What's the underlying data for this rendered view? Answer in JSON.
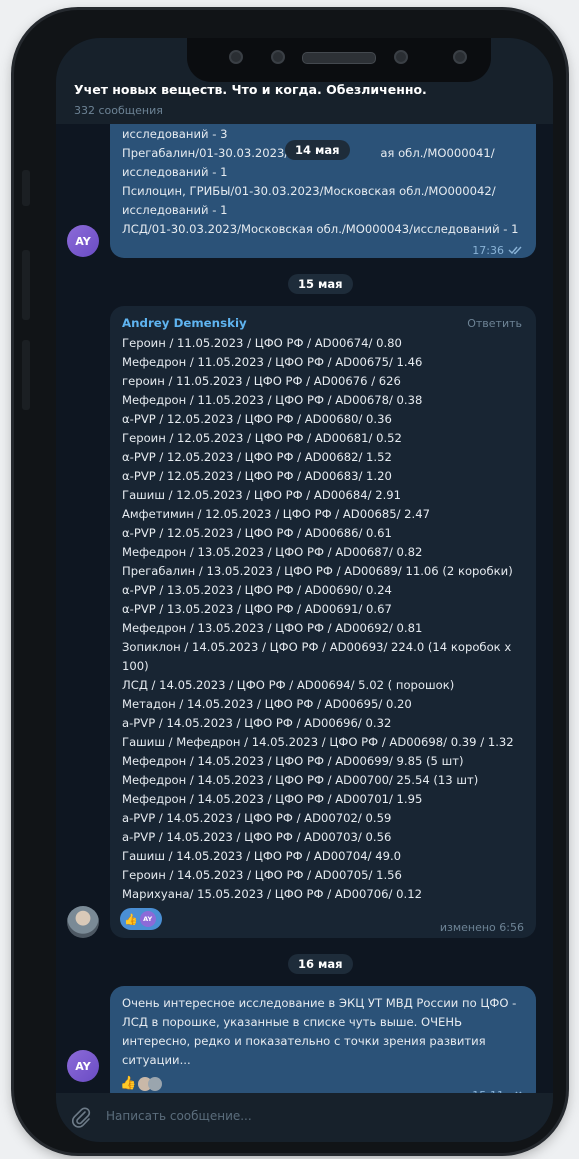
{
  "header": {
    "title": "Учет новых веществ. Что и когда. Обезличенно.",
    "subtitle": "332 сообщения"
  },
  "dates": {
    "floating": "14 мая",
    "d15": "15 мая",
    "d16": "16 мая"
  },
  "msg1": {
    "lines": [
      "исследований - 3",
      "Прегабалин/01-30.03.2023/М",
      "ая обл./МО000041/",
      "исследований - 1",
      "Псилоцин, ГРИБЫ/01-30.03.2023/Московская обл./МО000042/",
      "исследований - 1",
      "ЛСД/01-30.03.2023/Московская обл./МО000043/исследований - 1"
    ],
    "time": "17:36",
    "avatar": "AY"
  },
  "msg2": {
    "sender": "Andrey Demenskiy",
    "reply": "Ответить",
    "lines": [
      "Героин / 11.05.2023 / ЦФО РФ / AD00674/ 0.80",
      "Мефедрон / 11.05.2023 / ЦФО РФ / AD00675/ 1.46",
      "героин / 11.05.2023 / ЦФО РФ / AD00676 / 626",
      "Мефедрон / 11.05.2023 / ЦФО РФ / AD00678/ 0.38",
      "α-PVP / 12.05.2023 / ЦФО РФ / AD00680/ 0.36",
      "Героин / 12.05.2023 / ЦФО РФ / AD00681/ 0.52",
      "α-PVP / 12.05.2023 / ЦФО РФ / AD00682/ 1.52",
      "α-PVP / 12.05.2023 / ЦФО РФ / AD00683/ 1.20",
      "Гашиш / 12.05.2023 / ЦФО РФ / AD00684/ 2.91",
      "Амфетимин / 12.05.2023 / ЦФО РФ / AD00685/ 2.47",
      "α-PVP / 12.05.2023 / ЦФО РФ / AD00686/ 0.61",
      "Мефедрон / 13.05.2023 / ЦФО РФ / AD00687/ 0.82",
      "Прегабалин / 13.05.2023 / ЦФО РФ / AD00689/ 11.06 (2 коробки)",
      "α-PVP / 13.05.2023 / ЦФО РФ / AD00690/ 0.24",
      "α-PVP / 13.05.2023 / ЦФО РФ / AD00691/ 0.67",
      "Мефедрон / 13.05.2023 / ЦФО РФ / AD00692/ 0.81",
      "Зопиклон / 14.05.2023 / ЦФО РФ / AD00693/ 224.0 (14 коробок х",
      "100)",
      "ЛСД / 14.05.2023 / ЦФО РФ / AD00694/ 5.02 ( порошок)",
      "Метадон / 14.05.2023 / ЦФО РФ / AD00695/ 0.20",
      "a-PVP / 14.05.2023 / ЦФО РФ / AD00696/ 0.32",
      "Гашиш / Мефедрон / 14.05.2023 / ЦФО РФ / AD00698/ 0.39 / 1.32",
      "Мефедрон / 14.05.2023 / ЦФО РФ / AD00699/ 9.85 (5 шт)",
      "Мефедрон / 14.05.2023 / ЦФО РФ / AD00700/ 25.54 (13 шт)",
      "Мефедрон / 14.05.2023 / ЦФО РФ / AD00701/ 1.95",
      "a-PVP / 14.05.2023 / ЦФО РФ / AD00702/ 0.59",
      "a-PVP / 14.05.2023 / ЦФО РФ / AD00703/ 0.56",
      "Гашиш / 14.05.2023 / ЦФО РФ / AD00704/ 49.0",
      "Героин / 14.05.2023 / ЦФО РФ / AD00705/ 1.56",
      "Марихуана/ 15.05.2023 / ЦФО РФ / AD00706/ 0.12"
    ],
    "reaction_emoji": "👍",
    "reaction_avatar": "AY",
    "time": "изменено 6:56"
  },
  "msg3": {
    "lines": [
      "Очень интересное исследование в ЭКЦ УТ МВД России по ЦФО -",
      "ЛСД в порошке, указанные в списке чуть выше. ОЧЕНЬ",
      "интересно, редко и показательно с точки зрения развития",
      "ситуации..."
    ],
    "reaction_emoji": "👍",
    "time": "15:11",
    "avatar": "AY"
  },
  "input": {
    "placeholder": "Написать сообщение..."
  },
  "colors": {
    "background": "#0e1621",
    "incoming_bubble": "#182533",
    "outgoing_bubble": "#2b5278",
    "sender_name": "#5fb4f0",
    "accent": "#4a8fd4"
  },
  "icons": [
    "attach-icon",
    "double-check-icon",
    "front-camera-icon",
    "speaker-icon"
  ]
}
